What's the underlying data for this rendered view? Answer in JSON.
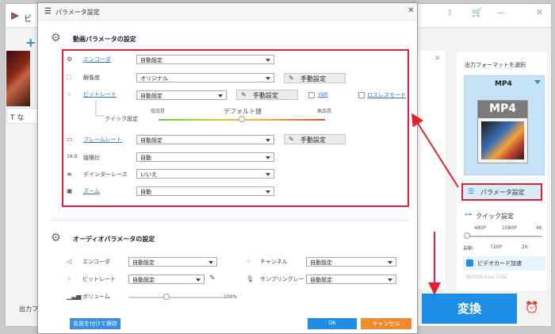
{
  "main_window": {
    "title_partial": "ビ",
    "thumb_label": "T な",
    "output_label": "出力フ",
    "output_panel_title": "出力フォーマットを選択",
    "format_name": "MP4",
    "format_icon_text": "MP4",
    "param_button_label": "パラメータ設定",
    "quick_settings_label": "クイック設定",
    "resolution_top": [
      "480P",
      "1080P",
      "4K"
    ],
    "resolution_bottom": [
      "自動",
      "720P",
      "2K"
    ],
    "gpu_label": "ビデオカード加速",
    "gpu_logos": "NVIDIA  intel  Intel",
    "convert_label": "変換",
    "accent_color": "#1d8de8",
    "highlight_color": "#e2202f"
  },
  "dialog": {
    "title": "パラメータ設定",
    "video_section_title": "動画パラメータの設定",
    "audio_section_title": "オーディオパラメータの設定",
    "video": {
      "encoder_label": "エンコーダ",
      "encoder_value": "自動設定",
      "resolution_label": "解像度",
      "resolution_value": "オリジナル",
      "resolution_manual": "手動設定",
      "bitrate_label": "ビットレート",
      "bitrate_value": "自動設定",
      "bitrate_manual": "手動設定",
      "vbr_label": "VBR",
      "lossless_label": "ロスレスモード",
      "quick_label": "クイック設定",
      "low_quality": "低品質",
      "default_value": "デフォルト値",
      "high_quality": "高品質",
      "quality_level": 0.5,
      "framerate_label": "フレームレート",
      "framerate_value": "自動設定",
      "framerate_manual": "手動設定",
      "aspect_label": "縦横比",
      "aspect_value": "自動",
      "deinterlace_label": "デインターレース",
      "deinterlace_value": "いいえ",
      "zoom_label": "ズーム",
      "zoom_value": "自動"
    },
    "audio": {
      "encoder_label": "エンコーダ",
      "encoder_value": "自動設定",
      "bitrate_label": "ビットレート",
      "bitrate_value": "自動設定",
      "channel_label": "チャンネル",
      "channel_value": "自動設定",
      "samplerate_label": "サンプリングレート",
      "samplerate_value": "自動設定",
      "volume_label": "ボリューム",
      "volume_value": "100%",
      "volume_level": 0.4
    },
    "footer": {
      "save_as": "名前を付けて保存",
      "ok": "Ok",
      "cancel": "キャンセル"
    }
  }
}
